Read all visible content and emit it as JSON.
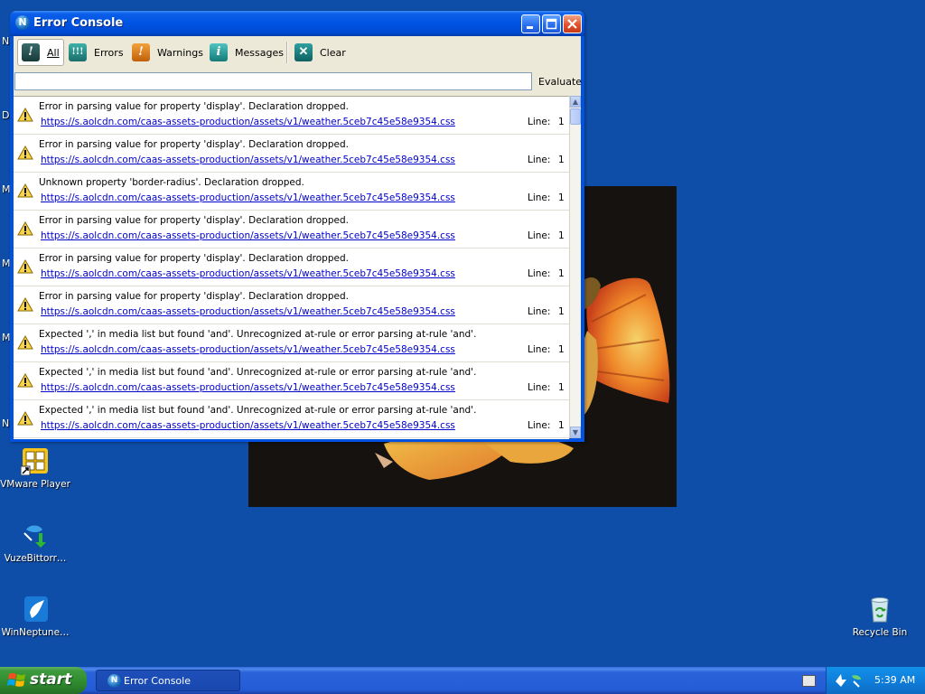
{
  "window": {
    "title": "Error Console",
    "toolbar": {
      "all": "All",
      "errors": "Errors",
      "warnings": "Warnings",
      "messages": "Messages",
      "clear": "Clear"
    },
    "evaluate_value": "",
    "evaluate_label": "Evaluate",
    "line_label": "Line:",
    "entries": [
      {
        "message": "Error in parsing value for property 'display'.  Declaration dropped.",
        "source": "https://s.aolcdn.com/caas-assets-production/assets/v1/weather.5ceb7c45e58e9354.css",
        "line": "1"
      },
      {
        "message": "Error in parsing value for property 'display'.  Declaration dropped.",
        "source": "https://s.aolcdn.com/caas-assets-production/assets/v1/weather.5ceb7c45e58e9354.css",
        "line": "1"
      },
      {
        "message": "Unknown property 'border-radius'.  Declaration dropped.",
        "source": "https://s.aolcdn.com/caas-assets-production/assets/v1/weather.5ceb7c45e58e9354.css",
        "line": "1"
      },
      {
        "message": "Error in parsing value for property 'display'.  Declaration dropped.",
        "source": "https://s.aolcdn.com/caas-assets-production/assets/v1/weather.5ceb7c45e58e9354.css",
        "line": "1"
      },
      {
        "message": "Error in parsing value for property 'display'.  Declaration dropped.",
        "source": "https://s.aolcdn.com/caas-assets-production/assets/v1/weather.5ceb7c45e58e9354.css",
        "line": "1"
      },
      {
        "message": "Error in parsing value for property 'display'.  Declaration dropped.",
        "source": "https://s.aolcdn.com/caas-assets-production/assets/v1/weather.5ceb7c45e58e9354.css",
        "line": "1"
      },
      {
        "message": "Expected ',' in media list but found 'and'.  Unrecognized at-rule or error parsing at-rule 'and'.",
        "source": "https://s.aolcdn.com/caas-assets-production/assets/v1/weather.5ceb7c45e58e9354.css",
        "line": "1"
      },
      {
        "message": "Expected ',' in media list but found 'and'.  Unrecognized at-rule or error parsing at-rule 'and'.",
        "source": "https://s.aolcdn.com/caas-assets-production/assets/v1/weather.5ceb7c45e58e9354.css",
        "line": "1"
      },
      {
        "message": "Expected ',' in media list but found 'and'.  Unrecognized at-rule or error parsing at-rule 'and'.",
        "source": "https://s.aolcdn.com/caas-assets-production/assets/v1/weather.5ceb7c45e58e9354.css",
        "line": "1"
      }
    ]
  },
  "desktop": {
    "edge_letters": [
      "N",
      "D",
      "M",
      "M",
      "M",
      "N"
    ],
    "icons": {
      "vmware": "VMware Player",
      "vuze": "VuzeBittorr…",
      "winneptune": "WinNeptune…",
      "recycle": "Recycle Bin"
    }
  },
  "taskbar": {
    "start_label": "start",
    "task_label": "Error Console",
    "clock": "5:39 AM"
  },
  "colors": {
    "desktop": "#0f4ea8",
    "link": "#0000cc",
    "titlebar": "#0054e3"
  }
}
